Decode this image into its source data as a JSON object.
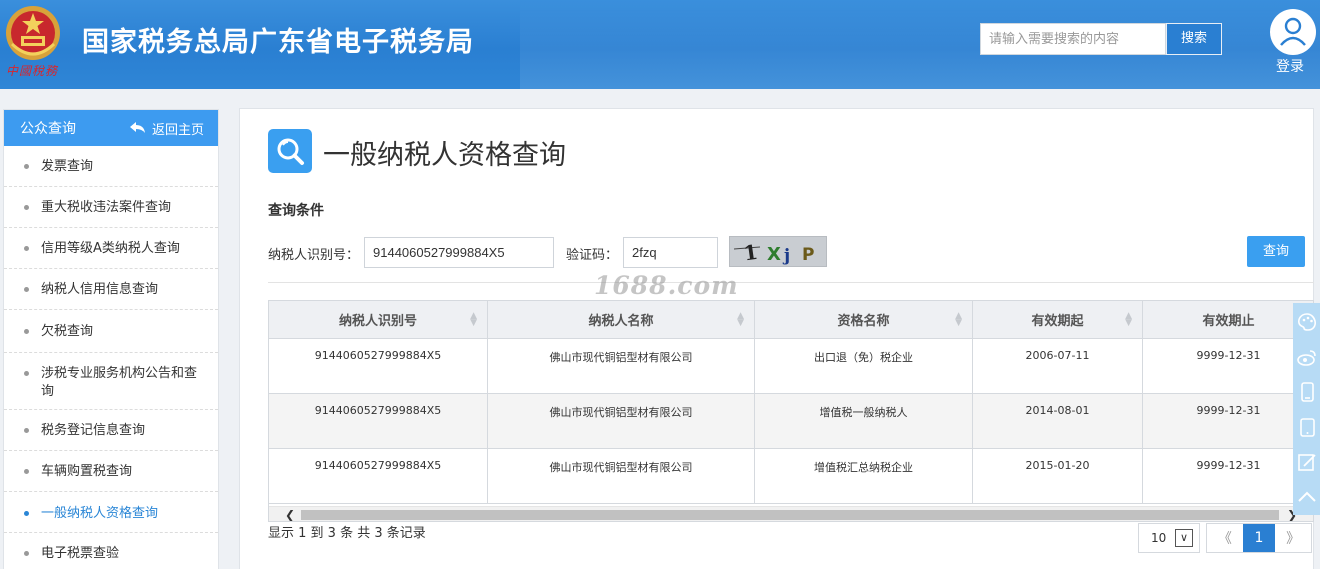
{
  "header": {
    "emblem_caption": "中國稅務",
    "site_title": "国家税务总局广东省电子税务局",
    "search_placeholder": "请输入需要搜索的内容",
    "search_button": "搜索",
    "login_label": "登录"
  },
  "sidebar": {
    "title": "公众查询",
    "back_label": "返回主页",
    "items": [
      {
        "label": "发票查询"
      },
      {
        "label": "重大税收违法案件查询"
      },
      {
        "label": "信用等级A类纳税人查询"
      },
      {
        "label": "纳税人信用信息查询"
      },
      {
        "label": "欠税查询"
      },
      {
        "label": "涉税专业服务机构公告和查询"
      },
      {
        "label": "税务登记信息查询"
      },
      {
        "label": "车辆购置税查询"
      },
      {
        "label": "一般纳税人资格查询",
        "active": true
      },
      {
        "label": "电子税票查验"
      }
    ]
  },
  "main": {
    "page_title": "一般纳税人资格查询",
    "section_label": "查询条件",
    "taxpayer_id_label": "纳税人识别号：",
    "taxpayer_id_value": "9144060527999884X5",
    "captcha_label": "验证码：",
    "captcha_value": "2fzq",
    "captcha_image_text": "1XjP",
    "query_button": "查询",
    "table": {
      "columns": [
        "纳税人识别号",
        "纳税人名称",
        "资格名称",
        "有效期起",
        "有效期止"
      ],
      "rows": [
        [
          "9144060527999884X5",
          "佛山市现代铜铝型材有限公司",
          "出口退（免）税企业",
          "2006-07-11",
          "9999-12-31"
        ],
        [
          "9144060527999884X5",
          "佛山市现代铜铝型材有限公司",
          "增值税一般纳税人",
          "2014-08-01",
          "9999-12-31"
        ],
        [
          "9144060527999884X5",
          "佛山市现代铜铝型材有限公司",
          "增值税汇总纳税企业",
          "2015-01-20",
          "9999-12-31"
        ]
      ]
    },
    "record_info": "显示 1 到 3 条 共 3 条记录",
    "page_size": "10",
    "pager": {
      "prev": "《",
      "current": "1",
      "next": "》"
    }
  },
  "watermark": "1688.com",
  "colors": {
    "header_blue": "#2a7fd2",
    "accent_blue": "#3a9ff0",
    "active_link": "#2a86d6"
  },
  "float_bar_icons": [
    "palette-icon",
    "weibo-icon",
    "mobile-icon",
    "tablet-icon",
    "edit-icon",
    "back-to-top-icon"
  ]
}
